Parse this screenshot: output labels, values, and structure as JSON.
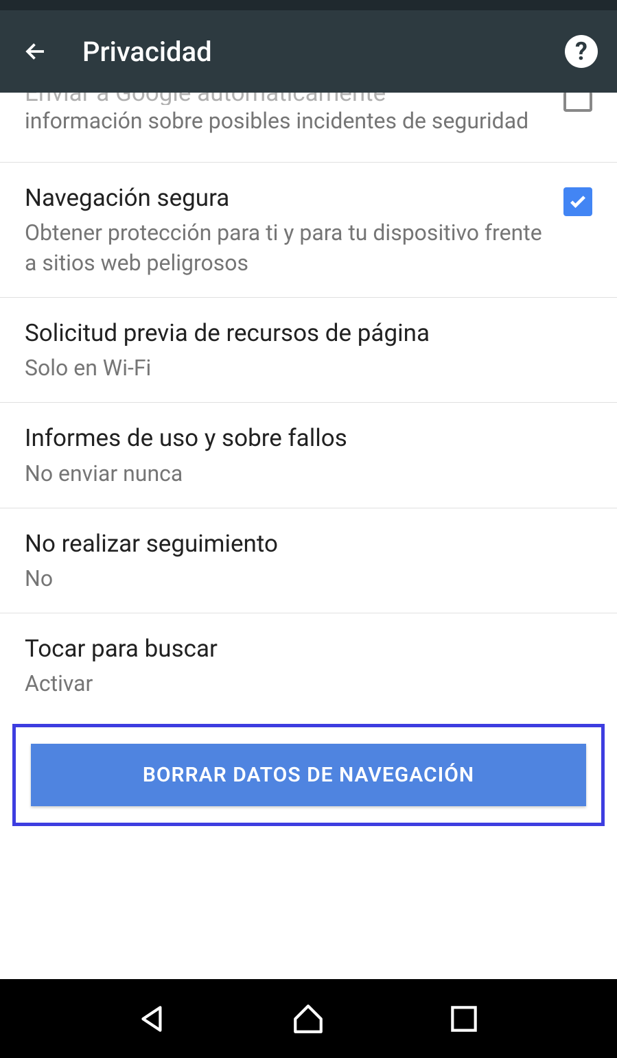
{
  "header": {
    "title": "Privacidad"
  },
  "settings": {
    "item0": {
      "title_cut": "Enviar a Google automáticamente",
      "subtitle": "información sobre posibles incidentes de seguridad",
      "checked": false
    },
    "item1": {
      "title": "Navegación segura",
      "subtitle": "Obtener protección para ti y para tu dispositivo frente a sitios web peligrosos",
      "checked": true
    },
    "item2": {
      "title": "Solicitud previa de recursos de página",
      "subtitle": "Solo en Wi-Fi"
    },
    "item3": {
      "title": "Informes de uso y sobre fallos",
      "subtitle": "No enviar nunca"
    },
    "item4": {
      "title": "No realizar seguimiento",
      "subtitle": "No"
    },
    "item5": {
      "title": "Tocar para buscar",
      "subtitle": "Activar"
    }
  },
  "clearButton": {
    "label": "BORRAR DATOS DE NAVEGACIÓN"
  }
}
